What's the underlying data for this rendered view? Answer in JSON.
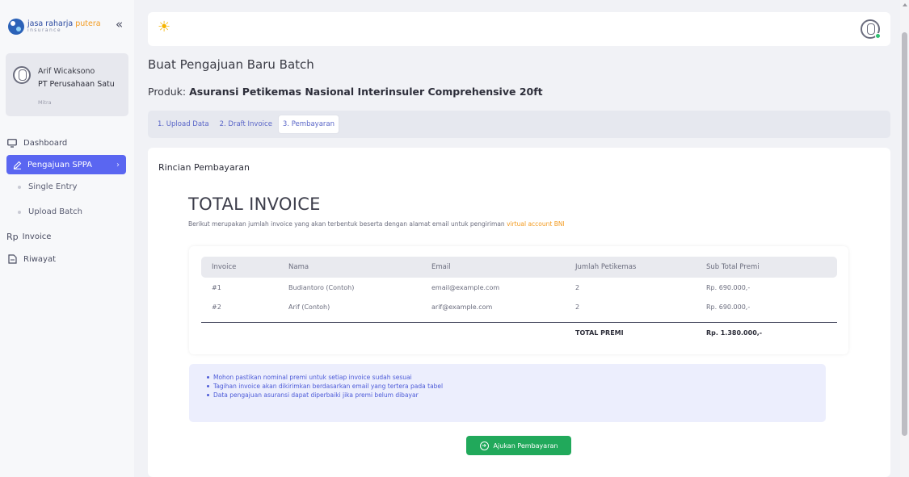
{
  "brand": {
    "name_part1": "jasa raharja ",
    "name_part2": "putera",
    "sub": "insurance"
  },
  "sidebar": {
    "collapse": "«",
    "user": {
      "name": "Arif Wicaksono",
      "company": "PT Perusahaan Satu",
      "role": "Mitra"
    },
    "items": [
      {
        "label": "Dashboard",
        "icon": "monitor-icon"
      },
      {
        "label": "Pengajuan SPPA",
        "icon": "pencil-icon",
        "active": true
      },
      {
        "label": "Single Entry",
        "sub": true
      },
      {
        "label": "Upload Batch",
        "sub": true
      },
      {
        "label": "Invoice",
        "icon": "rupiah-icon",
        "icon_text": "Rp"
      },
      {
        "label": "Riwayat",
        "icon": "document-icon"
      }
    ]
  },
  "header": {
    "title": "Buat Pengajuan Baru Batch",
    "product_label": "Produk:",
    "product_name": "Asuransi Petikemas Nasional Interinsuler Comprehensive 20ft"
  },
  "steps": [
    {
      "label": "1. Upload Data"
    },
    {
      "label": "2. Draft Invoice"
    },
    {
      "label": "3. Pembayaran",
      "active": true
    }
  ],
  "main": {
    "section_title": "Rincian Pembayaran",
    "big_title": "TOTAL INVOICE",
    "subtitle": "Berikut merupakan jumlah invoice yang akan terbentuk beserta dengan alamat email untuk pengiriman ",
    "subtitle_highlight": "virtual account BNI",
    "table": {
      "headers": [
        "Invoice",
        "Nama",
        "Email",
        "Jumlah Petikemas",
        "Sub Total Premi"
      ],
      "rows": [
        [
          "#1",
          "Budiantoro (Contoh)",
          "email@example.com",
          "2",
          "Rp. 690.000,-"
        ],
        [
          "#2",
          "Arif (Contoh)",
          "arif@example.com",
          "2",
          "Rp. 690.000,-"
        ]
      ],
      "total_label": "TOTAL PREMI",
      "total_value": "Rp. 1.380.000,-"
    },
    "notes": [
      "Mohon pastikan nominal premi untuk setiap invoice sudah sesuai",
      "Tagihan invoice akan dikirimkan berdasarkan email yang tertera pada tabel",
      "Data pengajuan asuransi dapat diperbaiki jika premi belum dibayar"
    ],
    "submit_label": "Ajukan Pembayaran"
  },
  "colors": {
    "accent": "#5a66f1",
    "success": "#21a95b",
    "highlight": "#f39a1e"
  }
}
